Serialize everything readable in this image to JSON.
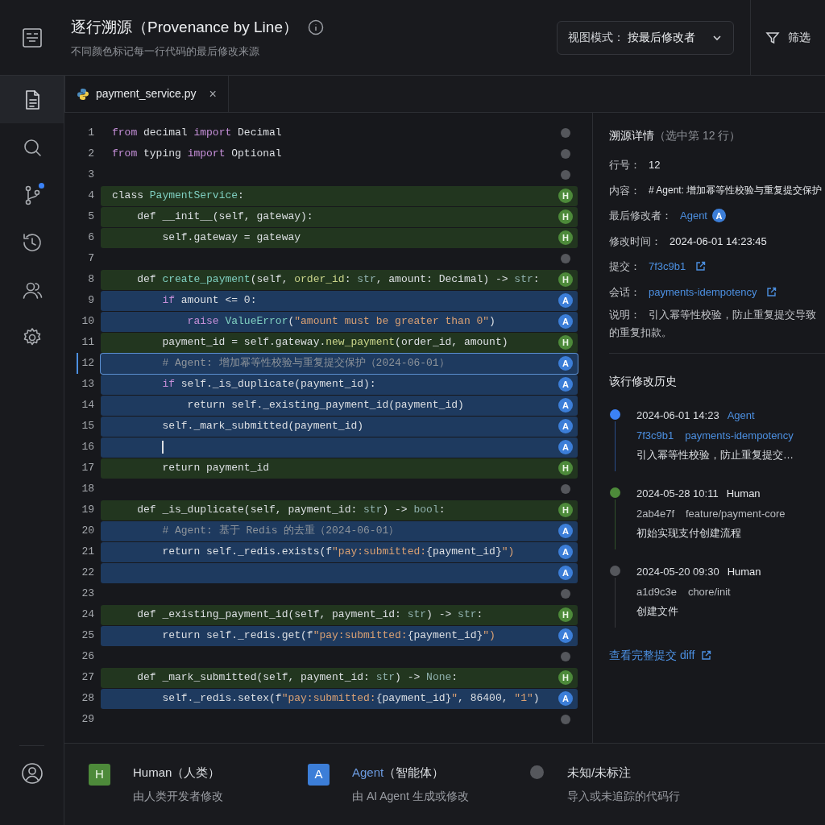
{
  "header": {
    "title": "逐行溯源（Provenance by Line）",
    "subtitle": "不同颜色标记每一行代码的最后修改来源",
    "view_mode": {
      "label": "视图模式：",
      "value": "按最后修改者"
    },
    "filter": "筛选"
  },
  "sidebar": [
    {
      "kind": "files",
      "selected": true,
      "dot": false
    },
    {
      "kind": "search",
      "selected": false,
      "dot": false
    },
    {
      "kind": "branch",
      "selected": false,
      "dot": true
    },
    {
      "kind": "history",
      "selected": false,
      "dot": false
    },
    {
      "kind": "users",
      "selected": false,
      "dot": false
    },
    {
      "kind": "settings",
      "selected": false,
      "dot": false
    }
  ],
  "tab": {
    "label": "payment_service.py",
    "close": "×"
  },
  "lines": [
    {
      "num": "1",
      "kind": "unknown",
      "selected": false,
      "cursor": false,
      "tokens": [
        {
          "text": "from",
          "kind": "kw"
        },
        {
          "text": " decimal ",
          "kind": "p"
        },
        {
          "text": "import",
          "kind": "kw"
        },
        {
          "text": " Decimal",
          "kind": "p"
        }
      ]
    },
    {
      "num": "2",
      "kind": "unknown",
      "selected": false,
      "cursor": false,
      "tokens": [
        {
          "text": "from",
          "kind": "kw"
        },
        {
          "text": " typing ",
          "kind": "p"
        },
        {
          "text": "import",
          "kind": "kw"
        },
        {
          "text": " Optional",
          "kind": "p"
        }
      ]
    },
    {
      "num": "3",
      "kind": "unknown",
      "selected": false,
      "cursor": false
    },
    {
      "num": "4",
      "kind": "human",
      "badge": "H",
      "selected": false,
      "cursor": false,
      "tokens": [
        {
          "text": "class ",
          "kind": "p"
        },
        {
          "text": "PaymentService",
          "kind": "fn"
        },
        {
          "text": ":",
          "kind": "p"
        }
      ]
    },
    {
      "num": "5",
      "kind": "human",
      "badge": "H",
      "selected": false,
      "cursor": false,
      "tokens": [
        {
          "text": "    def __init__(self, gateway):",
          "kind": "p"
        }
      ]
    },
    {
      "num": "6",
      "kind": "human",
      "badge": "H",
      "selected": false,
      "cursor": false,
      "tokens": [
        {
          "text": "        self.gateway = gateway",
          "kind": "p"
        }
      ]
    },
    {
      "num": "7",
      "kind": "unknown",
      "selected": false,
      "cursor": false
    },
    {
      "num": "8",
      "kind": "human",
      "badge": "H",
      "selected": false,
      "cursor": false,
      "tokens": [
        {
          "text": "    def ",
          "kind": "p"
        },
        {
          "text": "create_payment",
          "kind": "fn"
        },
        {
          "text": "(self, ",
          "kind": "p"
        },
        {
          "text": "order_id",
          "kind": "param"
        },
        {
          "text": ": ",
          "kind": "p"
        },
        {
          "text": "str",
          "kind": "type"
        },
        {
          "text": ", amount: Decimal) -> ",
          "kind": "p"
        },
        {
          "text": "str",
          "kind": "type"
        },
        {
          "text": ":",
          "kind": "p"
        }
      ]
    },
    {
      "num": "9",
      "kind": "agent",
      "badge": "A",
      "selected": false,
      "cursor": false,
      "tokens": [
        {
          "text": "        if",
          "kind": "kw"
        },
        {
          "text": " amount <= 0:",
          "kind": "p"
        }
      ]
    },
    {
      "num": "10",
      "kind": "agent",
      "badge": "A",
      "selected": false,
      "cursor": false,
      "tokens": [
        {
          "text": "            raise ",
          "kind": "kw"
        },
        {
          "text": "ValueError",
          "kind": "fn"
        },
        {
          "text": "(",
          "kind": "p"
        },
        {
          "text": "\"amount must be greater than 0\"",
          "kind": "str"
        },
        {
          "text": ")",
          "kind": "p"
        }
      ]
    },
    {
      "num": "11",
      "kind": "human",
      "badge": "H",
      "selected": false,
      "cursor": false,
      "tokens": [
        {
          "text": "        payment_id = self.gateway.",
          "kind": "p"
        },
        {
          "text": "new_payment",
          "kind": "param"
        },
        {
          "text": "(order_id, amount)",
          "kind": "p"
        }
      ]
    },
    {
      "num": "12",
      "kind": "agent",
      "badge": "A",
      "selected": true,
      "cursor": false,
      "tokens": [
        {
          "text": "        # Agent: 增加幂等性校验与重复提交保护（2024-06-01）",
          "kind": "com"
        }
      ]
    },
    {
      "num": "13",
      "kind": "agent",
      "badge": "A",
      "selected": false,
      "cursor": false,
      "tokens": [
        {
          "text": "        if",
          "kind": "kw"
        },
        {
          "text": " self._is_duplicate(payment_id):",
          "kind": "p"
        }
      ]
    },
    {
      "num": "14",
      "kind": "agent",
      "badge": "A",
      "selected": false,
      "cursor": false,
      "tokens": [
        {
          "text": "            return self._existing_payment_id(payment_id)",
          "kind": "p"
        }
      ]
    },
    {
      "num": "15",
      "kind": "agent",
      "badge": "A",
      "selected": false,
      "cursor": false,
      "tokens": [
        {
          "text": "        self._mark_submitted(payment_id)",
          "kind": "p"
        }
      ]
    },
    {
      "num": "16",
      "kind": "agent",
      "badge": "A",
      "selected": false,
      "cursor": true
    },
    {
      "num": "17",
      "kind": "human",
      "badge": "H",
      "selected": false,
      "cursor": false,
      "tokens": [
        {
          "text": "        return payment_id",
          "kind": "p"
        }
      ]
    },
    {
      "num": "18",
      "kind": "unknown",
      "selected": false,
      "cursor": false
    },
    {
      "num": "19",
      "kind": "human",
      "badge": "H",
      "selected": false,
      "cursor": false,
      "tokens": [
        {
          "text": "    def _is_duplicate(self, payment_id: ",
          "kind": "p"
        },
        {
          "text": "str",
          "kind": "type"
        },
        {
          "text": ") -> ",
          "kind": "p"
        },
        {
          "text": "bool",
          "kind": "type"
        },
        {
          "text": ":",
          "kind": "p"
        }
      ]
    },
    {
      "num": "20",
      "kind": "agent",
      "badge": "A",
      "selected": false,
      "cursor": false,
      "tokens": [
        {
          "text": "        # Agent: 基于 Redis 的去重（2024-06-01）",
          "kind": "com"
        }
      ]
    },
    {
      "num": "21",
      "kind": "agent",
      "badge": "A",
      "selected": false,
      "cursor": false,
      "tokens": [
        {
          "text": "        return self._redis.exists(f",
          "kind": "p"
        },
        {
          "text": "\"pay:submitted:",
          "kind": "str"
        },
        {
          "text": "{payment_id}",
          "kind": "p"
        },
        {
          "text": "\")",
          "kind": "str"
        }
      ]
    },
    {
      "num": "22",
      "kind": "agent",
      "badge": "A",
      "selected": false,
      "cursor": false
    },
    {
      "num": "23",
      "kind": "unknown",
      "selected": false,
      "cursor": false
    },
    {
      "num": "24",
      "kind": "human",
      "badge": "H",
      "selected": false,
      "cursor": false,
      "tokens": [
        {
          "text": "    def _existing_payment_id(self, payment_id: ",
          "kind": "p"
        },
        {
          "text": "str",
          "kind": "type"
        },
        {
          "text": ") -> ",
          "kind": "p"
        },
        {
          "text": "str",
          "kind": "type"
        },
        {
          "text": ":",
          "kind": "p"
        }
      ]
    },
    {
      "num": "25",
      "kind": "agent",
      "badge": "A",
      "selected": false,
      "cursor": false,
      "tokens": [
        {
          "text": "        return self._redis.get(f",
          "kind": "p"
        },
        {
          "text": "\"pay:submitted:",
          "kind": "str"
        },
        {
          "text": "{payment_id}",
          "kind": "p"
        },
        {
          "text": "\")",
          "kind": "str"
        }
      ]
    },
    {
      "num": "26",
      "kind": "unknown",
      "selected": false,
      "cursor": false
    },
    {
      "num": "27",
      "kind": "human",
      "badge": "H",
      "selected": false,
      "cursor": false,
      "tokens": [
        {
          "text": "    def _mark_submitted(self, payment_id: ",
          "kind": "p"
        },
        {
          "text": "str",
          "kind": "type"
        },
        {
          "text": ") -> ",
          "kind": "p"
        },
        {
          "text": "None",
          "kind": "type"
        },
        {
          "text": ":",
          "kind": "p"
        }
      ]
    },
    {
      "num": "28",
      "kind": "agent",
      "badge": "A",
      "selected": false,
      "cursor": false,
      "tokens": [
        {
          "text": "        self._redis.setex(f",
          "kind": "p"
        },
        {
          "text": "\"pay:submitted:",
          "kind": "str"
        },
        {
          "text": "{payment_id}",
          "kind": "p"
        },
        {
          "text": "\"",
          "kind": "str"
        },
        {
          "text": ", 86400, ",
          "kind": "p"
        },
        {
          "text": "\"1\"",
          "kind": "str"
        },
        {
          "text": ")",
          "kind": "p"
        }
      ]
    },
    {
      "num": "29",
      "kind": "unknown",
      "selected": false,
      "cursor": false
    }
  ],
  "details": {
    "title": "溯源详情",
    "title_note": "（选中第 12 行）",
    "rows": [
      {
        "kind": "text",
        "label": "行号：",
        "value": "12"
      },
      {
        "kind": "text",
        "label": "内容：",
        "value": "# Agent: 增加幂等性校验与重复提交保护"
      },
      {
        "kind": "author",
        "label": "最后修改者：",
        "value": "Agent",
        "badge": "A"
      },
      {
        "kind": "text",
        "label": "修改时间：",
        "value": "2024-06-01 14:23:45"
      },
      {
        "kind": "link",
        "label": "提交：",
        "value": "7f3c9b1"
      },
      {
        "kind": "link",
        "label": "会话：",
        "value": "payments-idempotency"
      },
      {
        "kind": "note",
        "label": "说明：",
        "value": "引入幂等性校验，防止重复提交导致的重复扣款。"
      }
    ]
  },
  "history": {
    "title": "该行修改历史",
    "items": [
      {
        "time": "2024-06-01 14:23",
        "author": "Agent",
        "kind": "agent",
        "hash": "7f3c9b1",
        "branch": "payments-idempotency",
        "message": "引入幂等性校验，防止重复提交…",
        "color": "#3b82f6"
      },
      {
        "time": "2024-05-28 10:11",
        "author": "Human",
        "kind": "human",
        "hash": "2ab4e7f",
        "branch": "feature/payment-core",
        "message": "初始实现支付创建流程",
        "color": "#4d8a3a"
      },
      {
        "time": "2024-05-20 09:30",
        "author": "Human",
        "kind": "human",
        "hash": "a1d9c3e",
        "branch": "chore/init",
        "message": "创建文件",
        "color": "#55575c"
      }
    ],
    "link": "查看完整提交 diff"
  },
  "legend": [
    {
      "kind": "human",
      "badge": "H",
      "name": "Human",
      "suffix": "（人类）",
      "desc": "由人类开发者修改"
    },
    {
      "kind": "agent",
      "badge": "A",
      "name": "Agent",
      "suffix": "（智能体）",
      "desc": "由 AI Agent 生成或修改"
    },
    {
      "kind": "unknown",
      "name": "未知/未标注",
      "desc": "导入或未追踪的代码行"
    }
  ]
}
